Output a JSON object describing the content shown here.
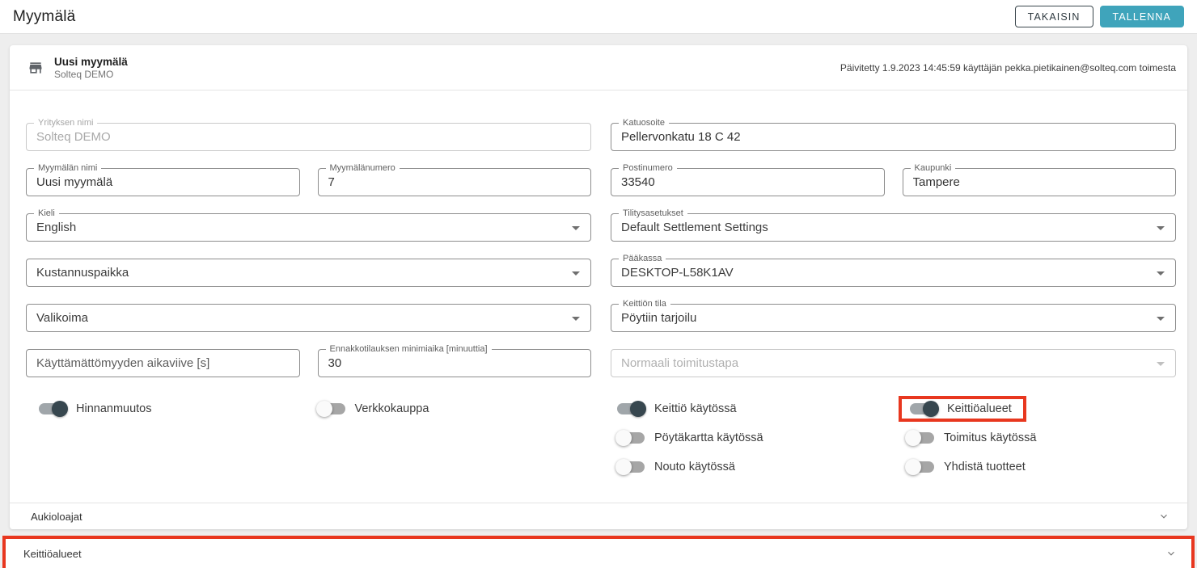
{
  "page": {
    "title": "Myymälä"
  },
  "toolbar": {
    "back_label": "TAKAISIN",
    "save_label": "TALLENNA"
  },
  "card": {
    "title": "Uusi myymälä",
    "subtitle": "Solteq DEMO",
    "updated": "Päivitetty 1.9.2023 14:45:59 käyttäjän pekka.pietikainen@solteq.com toimesta"
  },
  "fields": {
    "company_name": {
      "label": "Yrityksen nimi",
      "value": "Solteq DEMO",
      "disabled": true
    },
    "street_address": {
      "label": "Katuosoite",
      "value": "Pellervonkatu 18 C 42"
    },
    "store_name": {
      "label": "Myymälän nimi",
      "value": "Uusi myymälä"
    },
    "store_number": {
      "label": "Myymälänumero",
      "value": "7"
    },
    "postal_code": {
      "label": "Postinumero",
      "value": "33540"
    },
    "city": {
      "label": "Kaupunki",
      "value": "Tampere"
    },
    "language": {
      "label": "Kieli",
      "value": "English"
    },
    "settlement": {
      "label": "Tilitysasetukset",
      "value": "Default Settlement Settings"
    },
    "cost_center": {
      "placeholder": "Kustannuspaikka"
    },
    "main_register": {
      "label": "Pääkassa",
      "value": "DESKTOP-L58K1AV"
    },
    "assortment": {
      "placeholder": "Valikoima"
    },
    "kitchen_mode": {
      "label": "Keittiön tila",
      "value": "Pöytiin tarjoilu"
    },
    "idle_timeout": {
      "placeholder": "Käyttämättömyyden aikaviive [s]",
      "value": ""
    },
    "preorder_min": {
      "label": "Ennakkotilauksen minimiaika [minuuttia]",
      "value": "30"
    },
    "default_delivery": {
      "placeholder": "Normaali toimitustapa",
      "disabled": true
    }
  },
  "toggles": {
    "price_change": {
      "label": "Hinnanmuutos",
      "on": true
    },
    "webshop": {
      "label": "Verkkokauppa",
      "on": false
    },
    "kitchen_enabled": {
      "label": "Keittiö käytössä",
      "on": true
    },
    "kitchen_areas": {
      "label": "Keittiöalueet",
      "on": true,
      "highlighted": true
    },
    "table_map": {
      "label": "Pöytäkartta käytössä",
      "on": false
    },
    "delivery": {
      "label": "Toimitus käytössä",
      "on": false
    },
    "pickup": {
      "label": "Nouto käytössä",
      "on": false
    },
    "combine_products": {
      "label": "Yhdistä tuotteet",
      "on": false
    }
  },
  "accordions": {
    "opening_hours": {
      "label": "Aukioloajat"
    },
    "kitchen_areas": {
      "label": "Keittiöalueet",
      "highlighted": true
    }
  },
  "colors": {
    "accent_teal": "#3fa4bb",
    "highlight_red": "#e8371f",
    "toggle_on": "#37474f"
  }
}
